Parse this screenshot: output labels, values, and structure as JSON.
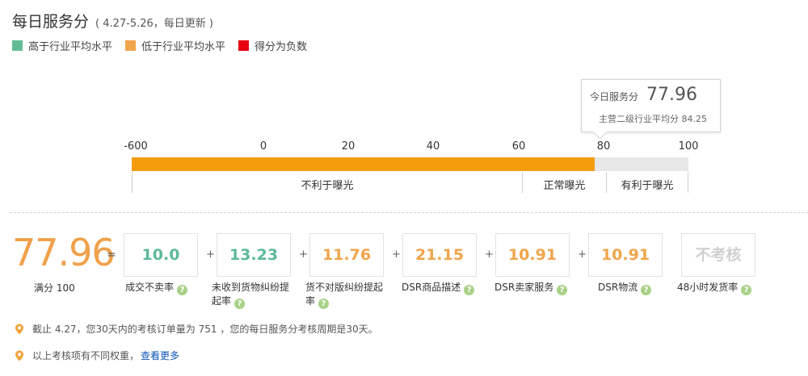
{
  "header": {
    "title": "每日服务分",
    "period": "( 4.27-5.26，每日更新 )"
  },
  "legend": [
    {
      "label": "高于行业平均水平",
      "color": "#62bd95"
    },
    {
      "label": "低于行业平均水平",
      "color": "#f0a54b"
    },
    {
      "label": "得分为负数",
      "color": "#e60012"
    }
  ],
  "tooltip": {
    "today_label": "今日服务分",
    "today_value": "77.96",
    "industry_label": "主营二级行业平均分",
    "industry_value": "84.25"
  },
  "scale": {
    "ticks": [
      "-600",
      "0",
      "20",
      "40",
      "60",
      "80",
      "100"
    ],
    "progress_value": 77.96,
    "zones": [
      "不利于曝光",
      "正常曝光",
      "有利于曝光"
    ]
  },
  "summary": {
    "score": "77.96",
    "equals": "=",
    "full_label": "满分 100",
    "plus": "+"
  },
  "components": [
    {
      "value": "10.0",
      "label1": "成交不卖率",
      "label2": "",
      "color": "#5db99a"
    },
    {
      "value": "13.23",
      "label1": "未收到货物纠纷提",
      "label2": "起率",
      "color": "#5db99a"
    },
    {
      "value": "11.76",
      "label1": "货不对版纠纷提起",
      "label2": "率",
      "color": "#f0a54b"
    },
    {
      "value": "21.15",
      "label1": "DSR商品描述",
      "label2": "",
      "color": "#f0a54b"
    },
    {
      "value": "10.91",
      "label1": "DSR卖家服务",
      "label2": "",
      "color": "#f0a54b"
    },
    {
      "value": "10.91",
      "label1": "DSR物流",
      "label2": "",
      "color": "#f0a54b"
    },
    {
      "value": "不考核",
      "label1": "48小时发货率",
      "label2": "",
      "color": "#cfcfcf"
    }
  ],
  "help_glyph": "?",
  "notes": {
    "note1": "截止 4.27，您30天内的考核订单量为 751 ，您的每日服务分考核周期是30天。",
    "note2": "以上考核项有不同权重，",
    "note2_link": "查看更多"
  }
}
